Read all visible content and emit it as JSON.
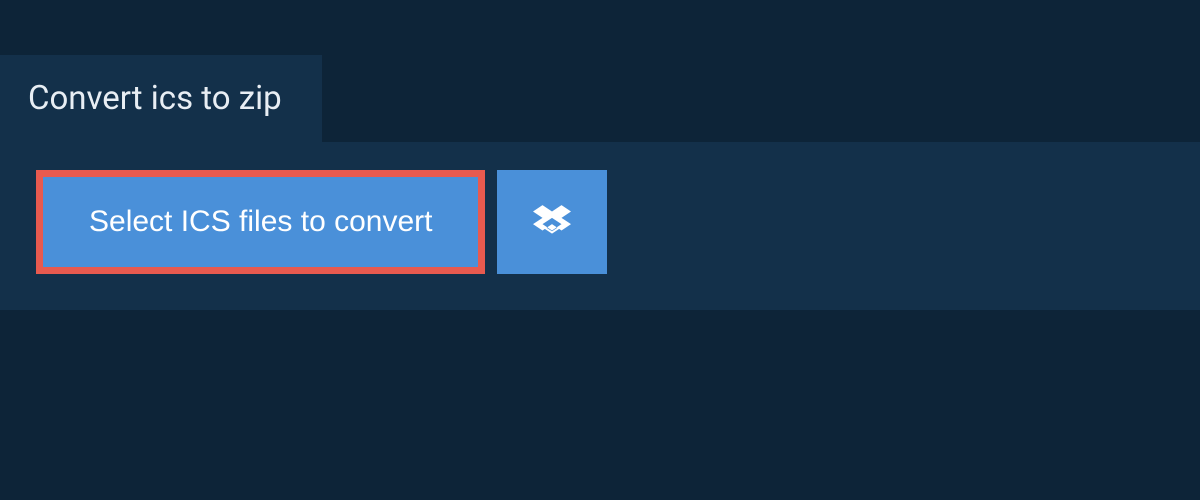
{
  "tab": {
    "label": "Convert ics to zip"
  },
  "actions": {
    "select_label": "Select ICS files to convert"
  }
}
